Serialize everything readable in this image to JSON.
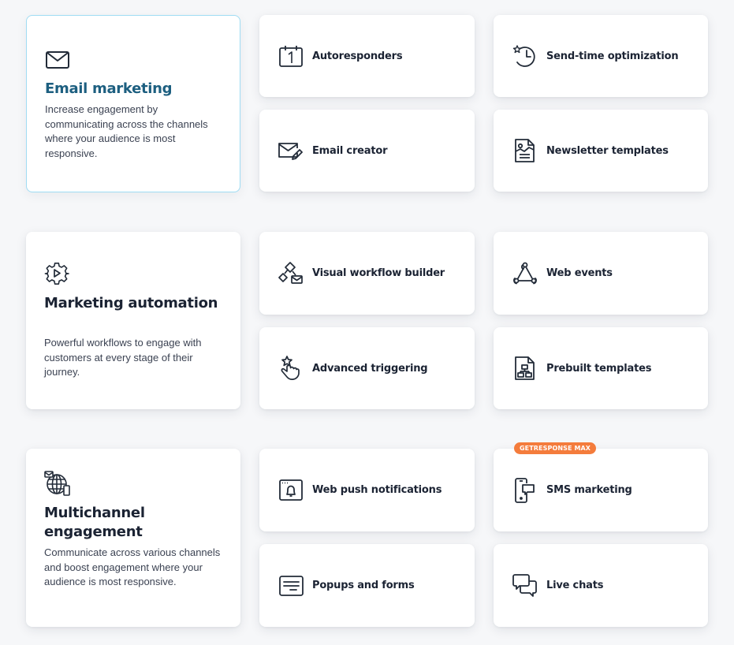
{
  "sections": [
    {
      "title": "Email marketing",
      "description": "Increase engagement by communicating across the channels where your audience is most responsive.",
      "icon": "envelope-icon",
      "active": true,
      "features": [
        {
          "label": "Autoresponders",
          "icon": "calendar-icon"
        },
        {
          "label": "Send-time optimization",
          "icon": "clock-star-icon"
        },
        {
          "label": "Email creator",
          "icon": "envelope-pen-icon"
        },
        {
          "label": "Newsletter templates",
          "icon": "document-image-icon"
        }
      ]
    },
    {
      "title": "Marketing automation",
      "description": "Powerful workflows to engage with customers at every stage of their journey.",
      "icon": "gear-play-icon",
      "active": false,
      "features": [
        {
          "label": "Visual workflow builder",
          "icon": "workflow-icon"
        },
        {
          "label": "Web events",
          "icon": "webhook-icon"
        },
        {
          "label": "Advanced triggering",
          "icon": "hand-star-icon"
        },
        {
          "label": "Prebuilt templates",
          "icon": "document-flowchart-icon"
        }
      ]
    },
    {
      "title": "Multichannel engagement",
      "description": "Communicate across various channels and boost engagement where your audience is most responsive.",
      "icon": "globe-channels-icon",
      "active": false,
      "features": [
        {
          "label": "Web push notifications",
          "icon": "browser-bell-icon"
        },
        {
          "label": "SMS marketing",
          "icon": "phone-message-icon",
          "badge": "GETRESPONSE MAX"
        },
        {
          "label": "Popups and forms",
          "icon": "popup-form-icon"
        },
        {
          "label": "Live chats",
          "icon": "chat-bubbles-icon"
        }
      ]
    }
  ],
  "colors": {
    "active_title": "#1d5f80",
    "active_border": "#9fdcf3",
    "badge": "#f47c3c",
    "text": "#1b2333",
    "background": "#f6f7f9"
  }
}
